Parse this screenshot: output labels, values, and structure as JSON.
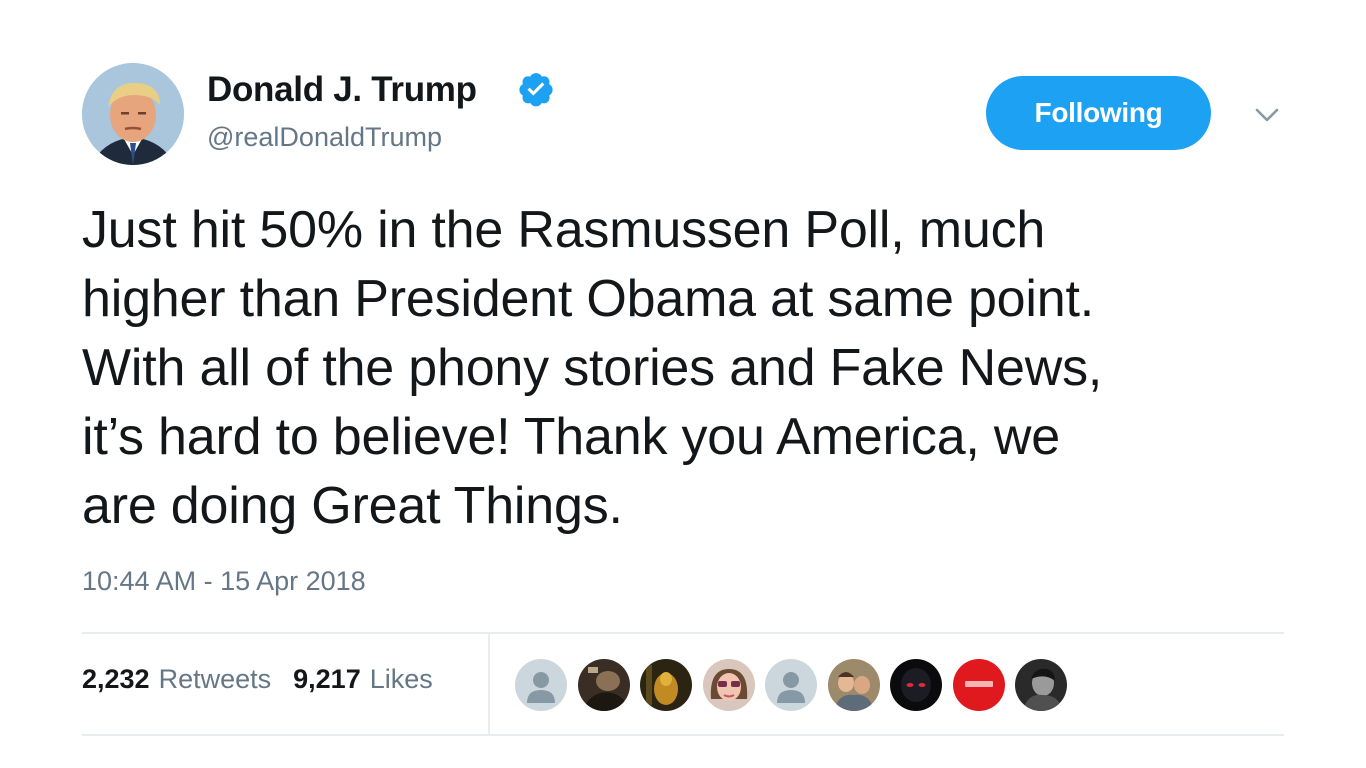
{
  "user": {
    "display_name": "Donald J. Trump",
    "handle": "@realDonaldTrump",
    "verified": true,
    "avatar_icon": "profile-photo"
  },
  "follow_button": {
    "label": "Following"
  },
  "menu_icon": "chevron-down-icon",
  "tweet": {
    "lines": [
      "Just hit 50% in the Rasmussen Poll, much",
      "higher than President Obama at same point.",
      "With all of the phony stories and Fake News,",
      "it’s hard to believe! Thank you America, we",
      "are doing Great Things."
    ],
    "timestamp": "10:44 AM - 15 Apr 2018"
  },
  "stats": {
    "retweets": {
      "count": "2,232",
      "label": "Retweets"
    },
    "likes": {
      "count": "9,217",
      "label": "Likes"
    }
  },
  "colors": {
    "accent": "#1da1f2",
    "secondary_text": "#657786",
    "primary_text": "#14171a",
    "divider": "#e6ecf0"
  },
  "likers": [
    {
      "icon": "default-avatar-icon"
    },
    {
      "icon": "profile-photo"
    },
    {
      "icon": "profile-photo"
    },
    {
      "icon": "profile-photo"
    },
    {
      "icon": "default-avatar-icon"
    },
    {
      "icon": "profile-photo"
    },
    {
      "icon": "profile-photo"
    },
    {
      "icon": "profile-photo"
    },
    {
      "icon": "profile-photo"
    }
  ]
}
